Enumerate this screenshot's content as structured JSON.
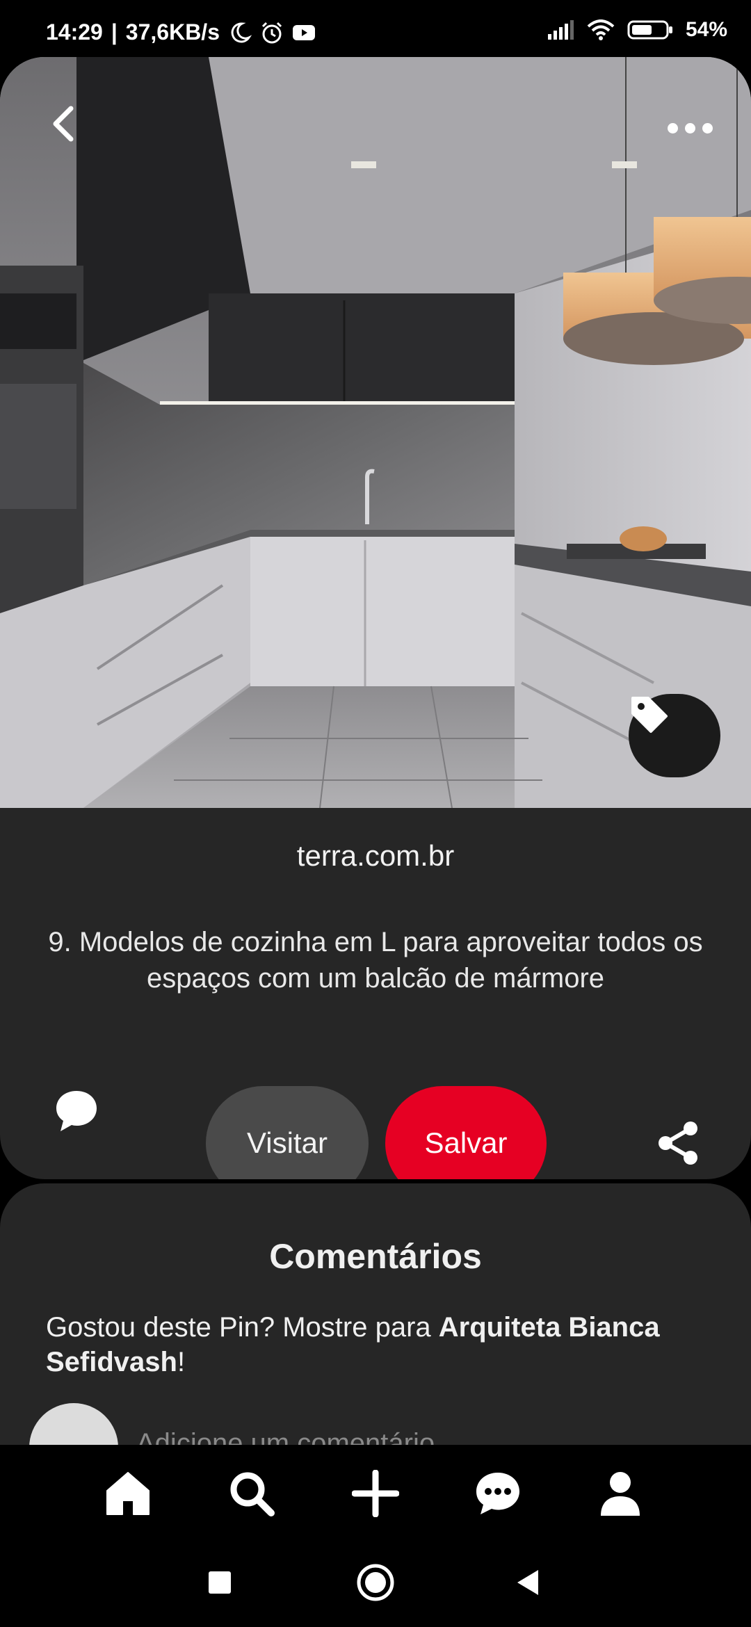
{
  "status_bar": {
    "time": "14:29",
    "speed": "37,6KB/s",
    "battery": "54%"
  },
  "pin": {
    "image_alt": "Cozinha em L moderna com balcão de mármore",
    "source": "terra.com.br",
    "description": "9. Modelos de cozinha em L para aproveitar todos os espaços com um balcão de mármore",
    "visit_label": "Visitar",
    "save_label": "Salvar",
    "save_color": "#e60023"
  },
  "comments": {
    "title": "Comentários",
    "prompt_prefix": "Gostou deste Pin? Mostre para ",
    "author": "Arquiteta Bianca Sefidvash",
    "prompt_suffix": "!",
    "input_placeholder": "Adicione um comentário"
  },
  "bottom_nav": [
    "home-icon",
    "search-icon",
    "plus-icon",
    "chat-icon",
    "profile-icon"
  ],
  "system_nav": [
    "recents-icon",
    "home-circle-icon",
    "back-triangle-icon"
  ]
}
